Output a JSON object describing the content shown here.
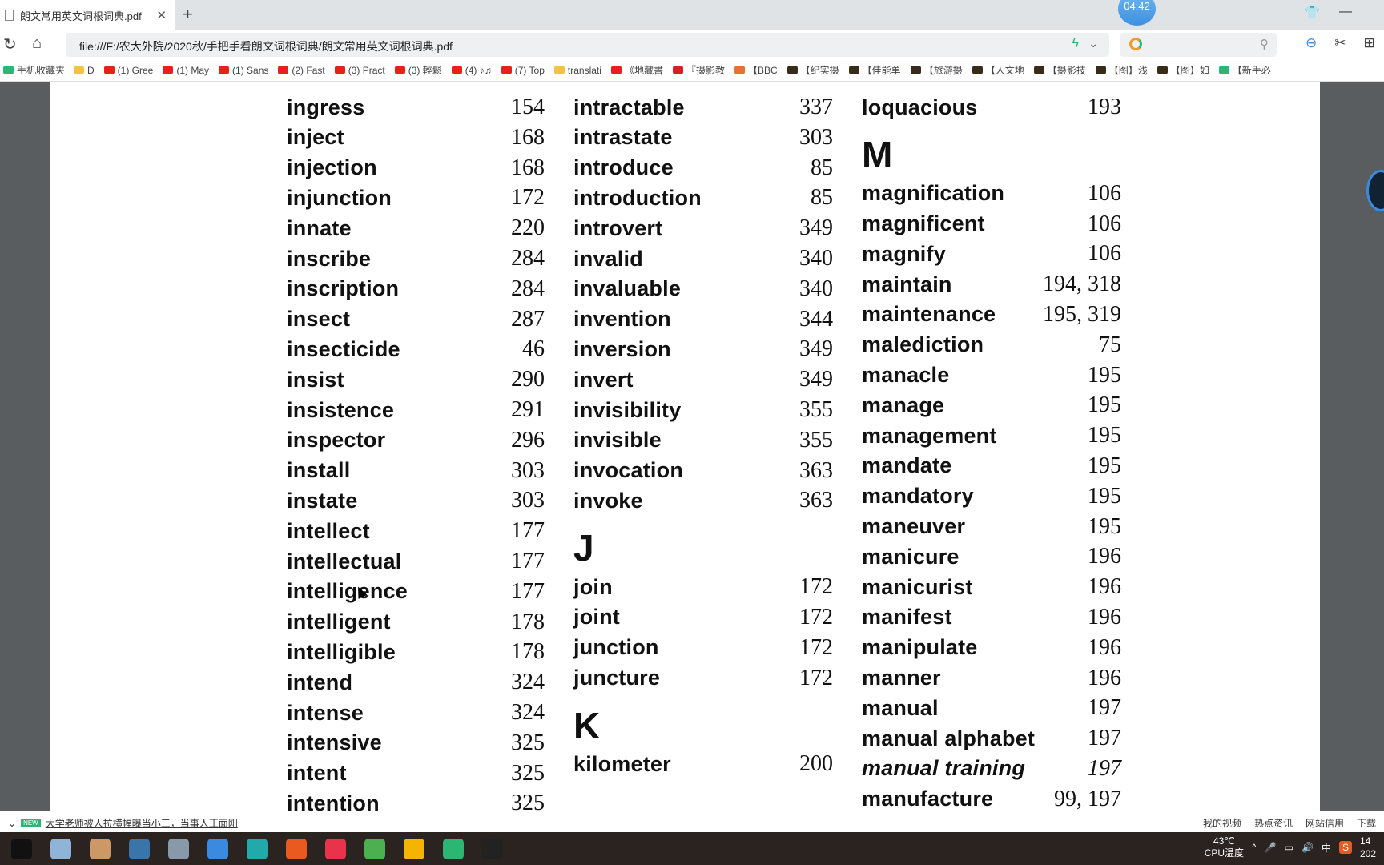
{
  "browser": {
    "tab_title": "朗文常用英文词根词典.pdf",
    "clock_bubble": "04:42",
    "url": "file:///F:/农大外院/2020秋/手把手看朗文词根词典/朗文常用英文词根词典.pdf",
    "bookmarks": [
      {
        "label": "手机收藏夹",
        "icon": "phone-icon",
        "color": "#2bb673"
      },
      {
        "label": "D",
        "icon": "folder-icon",
        "color": "#f5c342"
      },
      {
        "label": "(1) Gree",
        "icon": "youtube-icon",
        "color": "#e62117"
      },
      {
        "label": "(1) May",
        "icon": "youtube-icon",
        "color": "#e62117"
      },
      {
        "label": "(1) Sans",
        "icon": "youtube-icon",
        "color": "#e62117"
      },
      {
        "label": "(2) Fast",
        "icon": "youtube-icon",
        "color": "#e62117"
      },
      {
        "label": "(3) Pract",
        "icon": "youtube-icon",
        "color": "#e62117"
      },
      {
        "label": "(3) 輕鬆",
        "icon": "youtube-icon",
        "color": "#e62117"
      },
      {
        "label": "(4) ♪♫",
        "icon": "youtube-icon",
        "color": "#e62117"
      },
      {
        "label": "(7) Top",
        "icon": "youtube-icon",
        "color": "#e62117"
      },
      {
        "label": "translati",
        "icon": "folder-icon",
        "color": "#f5c342"
      },
      {
        "label": "《地藏書",
        "icon": "youtube-icon",
        "color": "#e62117"
      },
      {
        "label": "『摄影教",
        "icon": "netflix-icon",
        "color": "#d81f26"
      },
      {
        "label": "【BBC",
        "icon": "weibo-icon",
        "color": "#e6722e"
      },
      {
        "label": "【纪实摄",
        "icon": "site-icon",
        "color": "#3a2a1a"
      },
      {
        "label": "【佳能单",
        "icon": "site-icon",
        "color": "#3a2a1a"
      },
      {
        "label": "【旅游摄",
        "icon": "site-icon",
        "color": "#3a2a1a"
      },
      {
        "label": "【人文地",
        "icon": "site-icon",
        "color": "#3a2a1a"
      },
      {
        "label": "【摄影技",
        "icon": "site-icon",
        "color": "#3a2a1a"
      },
      {
        "label": "【图】浅",
        "icon": "site-icon",
        "color": "#3a2a1a"
      },
      {
        "label": "【图】如",
        "icon": "site-icon",
        "color": "#3a2a1a"
      },
      {
        "label": "【新手必",
        "icon": "refresh-site-icon",
        "color": "#2bb673"
      }
    ]
  },
  "dictionary": {
    "columns": [
      [
        {
          "word": "ingress",
          "page": "154"
        },
        {
          "word": "inject",
          "page": "168"
        },
        {
          "word": "injection",
          "page": "168"
        },
        {
          "word": "injunction",
          "page": "172"
        },
        {
          "word": "innate",
          "page": "220"
        },
        {
          "word": "inscribe",
          "page": "284"
        },
        {
          "word": "inscription",
          "page": "284"
        },
        {
          "word": "insect",
          "page": "287"
        },
        {
          "word": "insecticide",
          "page": "46"
        },
        {
          "word": "insist",
          "page": "290"
        },
        {
          "word": "insistence",
          "page": "291"
        },
        {
          "word": "inspector",
          "page": "296"
        },
        {
          "word": "install",
          "page": "303"
        },
        {
          "word": "instate",
          "page": "303"
        },
        {
          "word": "intellect",
          "page": "177"
        },
        {
          "word": "intellectual",
          "page": "177"
        },
        {
          "word": "intelligence",
          "page": "177"
        },
        {
          "word": "intelligent",
          "page": "178"
        },
        {
          "word": "intelligible",
          "page": "178"
        },
        {
          "word": "intend",
          "page": "324"
        },
        {
          "word": "intense",
          "page": "324"
        },
        {
          "word": "intensive",
          "page": "325"
        },
        {
          "word": "intent",
          "page": "325"
        },
        {
          "word": "intention",
          "page": "325"
        }
      ],
      [
        {
          "word": "intractable",
          "page": "337"
        },
        {
          "word": "intrastate",
          "page": "303"
        },
        {
          "word": "introduce",
          "page": "85"
        },
        {
          "word": "introduction",
          "page": "85"
        },
        {
          "word": "introvert",
          "page": "349"
        },
        {
          "word": "invalid",
          "page": "340"
        },
        {
          "word": "invaluable",
          "page": "340"
        },
        {
          "word": "invention",
          "page": "344"
        },
        {
          "word": "inversion",
          "page": "349"
        },
        {
          "word": "invert",
          "page": "349"
        },
        {
          "word": "invisibility",
          "page": "355"
        },
        {
          "word": "invisible",
          "page": "355"
        },
        {
          "word": "invocation",
          "page": "363"
        },
        {
          "word": "invoke",
          "page": "363"
        },
        {
          "heading": "J"
        },
        {
          "word": "join",
          "page": "172"
        },
        {
          "word": "joint",
          "page": "172"
        },
        {
          "word": "junction",
          "page": "172"
        },
        {
          "word": "juncture",
          "page": "172"
        },
        {
          "heading": "K"
        },
        {
          "word": "kilometer",
          "page": "200"
        }
      ],
      [
        {
          "word": "loquacious",
          "page": "193"
        },
        {
          "heading": "M"
        },
        {
          "word": "magnification",
          "page": "106"
        },
        {
          "word": "magnificent",
          "page": "106"
        },
        {
          "word": "magnify",
          "page": "106"
        },
        {
          "word": "maintain",
          "page": "194, 318"
        },
        {
          "word": "maintenance",
          "page": "195, 319"
        },
        {
          "word": "malediction",
          "page": "75"
        },
        {
          "word": "manacle",
          "page": "195"
        },
        {
          "word": "manage",
          "page": "195"
        },
        {
          "word": "management",
          "page": "195"
        },
        {
          "word": "mandate",
          "page": "195"
        },
        {
          "word": "mandatory",
          "page": "195"
        },
        {
          "word": "maneuver",
          "page": "195"
        },
        {
          "word": "manicure",
          "page": "196"
        },
        {
          "word": "manicurist",
          "page": "196"
        },
        {
          "word": "manifest",
          "page": "196"
        },
        {
          "word": "manipulate",
          "page": "196"
        },
        {
          "word": "manner",
          "page": "196"
        },
        {
          "word": "manual",
          "page": "197"
        },
        {
          "word": "manual alphabet",
          "page": "197"
        },
        {
          "word": "manual training",
          "page": "197",
          "italic": true
        },
        {
          "word": "manufacture",
          "page": "99, 197"
        }
      ]
    ]
  },
  "statusbar": {
    "news_badge": "NEW",
    "news": "大学老师被人拉横幅曝当小三，当事人正面刚",
    "items": [
      "我的视频",
      "热点资讯",
      "网站信用",
      "下载"
    ]
  },
  "taskbar": {
    "apps": [
      {
        "icon": "terminal-icon",
        "color": "#111"
      },
      {
        "icon": "settings-app-icon",
        "color": "#8fb4d8"
      },
      {
        "icon": "app-icon",
        "color": "#c96"
      },
      {
        "icon": "python-icon",
        "color": "#3b74a8"
      },
      {
        "icon": "disk-icon",
        "color": "#8899aa"
      },
      {
        "icon": "baidu-netdisk-icon",
        "color": "#3a8be0"
      },
      {
        "icon": "app-icon",
        "color": "#2aa"
      },
      {
        "icon": "app-icon",
        "color": "#e85a20"
      },
      {
        "icon": "xmind-icon",
        "color": "#e8334a"
      },
      {
        "icon": "browser-icon",
        "color": "#4caf50"
      },
      {
        "icon": "chrome-icon",
        "color": "#f5b400"
      },
      {
        "icon": "wechat-icon",
        "color": "#2bb673"
      },
      {
        "icon": "qq-icon",
        "color": "#222"
      }
    ],
    "temperature": "43℃",
    "temperature_label": "CPU温度",
    "ime": "中",
    "time_partial": "14",
    "date_partial": "202"
  }
}
